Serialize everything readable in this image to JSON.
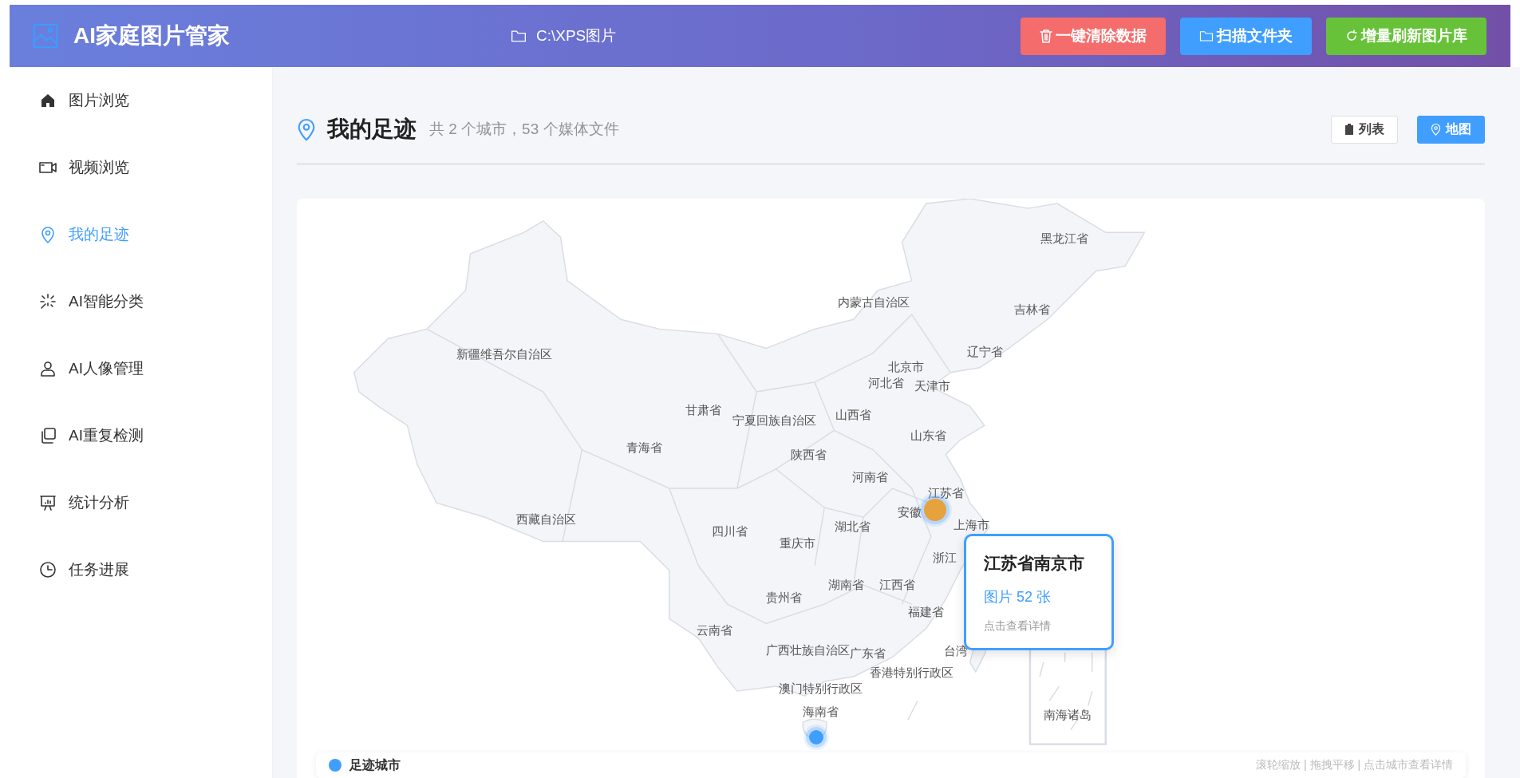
{
  "header": {
    "title": "AI家庭图片管家",
    "folder": "C:\\XPS图片",
    "buttons": [
      {
        "label": "一键清除数据",
        "kind": "danger"
      },
      {
        "label": "扫描文件夹",
        "kind": "primary"
      },
      {
        "label": "增量刷新图片库",
        "kind": "success"
      }
    ]
  },
  "sidebar": {
    "items": [
      {
        "label": "图片浏览",
        "selected": false
      },
      {
        "label": "视频浏览",
        "selected": false
      },
      {
        "label": "我的足迹",
        "selected": true
      },
      {
        "label": "AI智能分类",
        "selected": false
      },
      {
        "label": "AI人像管理",
        "selected": false
      },
      {
        "label": "AI重复检测",
        "selected": false
      },
      {
        "label": "统计分析",
        "selected": false
      },
      {
        "label": "任务进展",
        "selected": false
      }
    ]
  },
  "page": {
    "title": "我的足迹",
    "summary": "共 2 个城市，53 个媒体文件",
    "views": [
      {
        "label": "列表",
        "selected": false
      },
      {
        "label": "地图",
        "selected": true
      }
    ]
  },
  "map": {
    "regions": [
      "黑龙江省",
      "内蒙古自治区",
      "吉林省",
      "新疆维吾尔自治区",
      "辽宁省",
      "北京市",
      "河北省",
      "天津市",
      "甘肃省",
      "宁夏回族自治区",
      "山西省",
      "山东省",
      "青海省",
      "陕西省",
      "河南省",
      "江苏省",
      "安徽",
      "上海市",
      "西藏自治区",
      "四川省",
      "湖北省",
      "重庆市",
      "浙江",
      "湖南省",
      "江西省",
      "贵州省",
      "福建省",
      "云南省",
      "广西壮族自治区",
      "广东省",
      "台湾",
      "香港特别行政区",
      "澳门特别行政区",
      "海南省",
      "南海诸岛"
    ],
    "markers": [
      {
        "color": "#e6a23c"
      },
      {
        "color": "#409eff"
      }
    ],
    "tooltip": {
      "title": "江苏省南京市",
      "count": "图片 52 张",
      "hint": "点击查看详情"
    },
    "legend": {
      "label": "足迹城市",
      "hint": "滚轮缩放 | 拖拽平移 | 点击城市查看详情"
    }
  }
}
